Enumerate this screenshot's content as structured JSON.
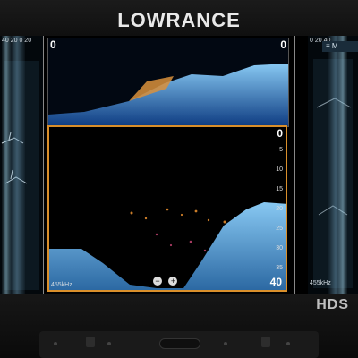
{
  "device": {
    "brand": "LOWRANCE",
    "model": "HDS"
  },
  "screen": {
    "left_side": {
      "scale_top": "40 20 0 20"
    },
    "center": {
      "top_pane": {
        "depth_top_left": "0",
        "depth_top_right": "0"
      },
      "bottom_pane": {
        "depth_top": "0",
        "depth_ticks": [
          "5",
          "10",
          "15",
          "20",
          "25",
          "30",
          "35"
        ],
        "frequency": "455kHz",
        "depth_bottom": "40",
        "zoom_out": "−",
        "zoom_in": "+"
      }
    },
    "right_side": {
      "scale_top": "0 20 40",
      "frequency": "455kHz",
      "menu_label": "≡ M"
    }
  }
}
